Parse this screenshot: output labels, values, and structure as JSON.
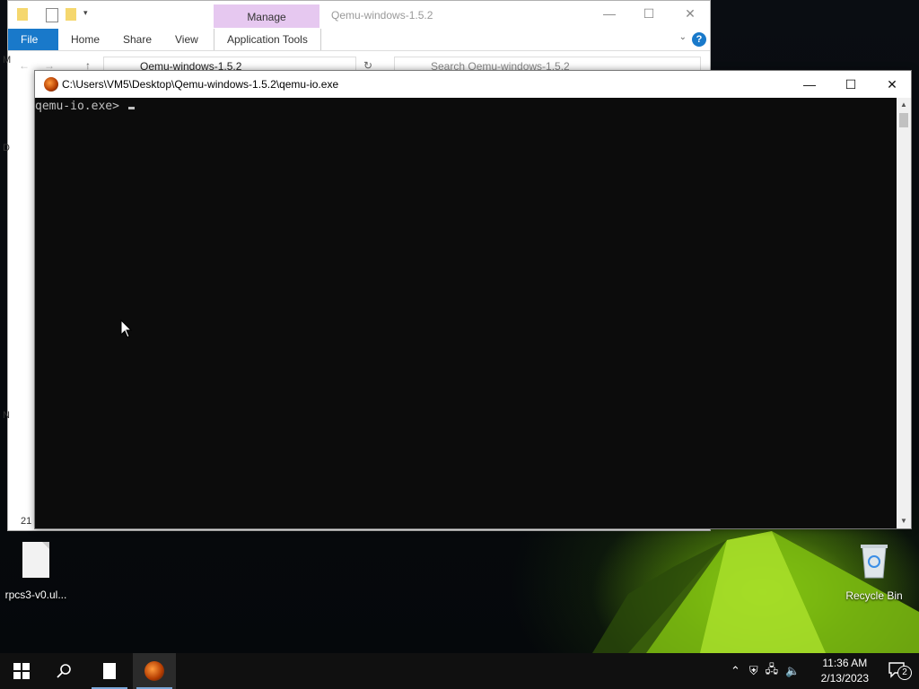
{
  "explorer": {
    "manage_tab": "Manage",
    "title": "Qemu-windows-1.5.2",
    "ribbon_tabs": [
      "File",
      "Home",
      "Share",
      "View",
      "Application Tools"
    ],
    "address_path": "Qemu-windows-1.5.2",
    "search_placeholder": "Search Qemu-windows-1.5.2",
    "left_pane_fragments": [
      "M",
      "D",
      "N"
    ],
    "status_item_count": "21"
  },
  "console": {
    "title": "C:\\Users\\VM5\\Desktop\\Qemu-windows-1.5.2\\qemu-io.exe",
    "prompt": "qemu-io.exe> "
  },
  "desktop": {
    "icons": [
      {
        "label": "rpcs3-v0.ul...",
        "icon": "file-icon"
      },
      {
        "label": "Recycle Bin",
        "icon": "recycle-bin-icon"
      }
    ]
  },
  "taskbar": {
    "items": [
      "start-icon",
      "search-icon",
      "file-explorer-icon",
      "qemu-icon"
    ],
    "tray_icons": [
      "chevron-up-icon",
      "security-icon",
      "network-icon",
      "volume-icon"
    ],
    "time": "11:36 AM",
    "date": "2/13/2023",
    "notification_count": "2"
  },
  "colors": {
    "accent": "#1979ca",
    "manage_tab": "#e6c8f0",
    "console_bg": "#0c0c0c",
    "console_text": "#c0c0c0",
    "taskbar_bg": "#101010"
  }
}
